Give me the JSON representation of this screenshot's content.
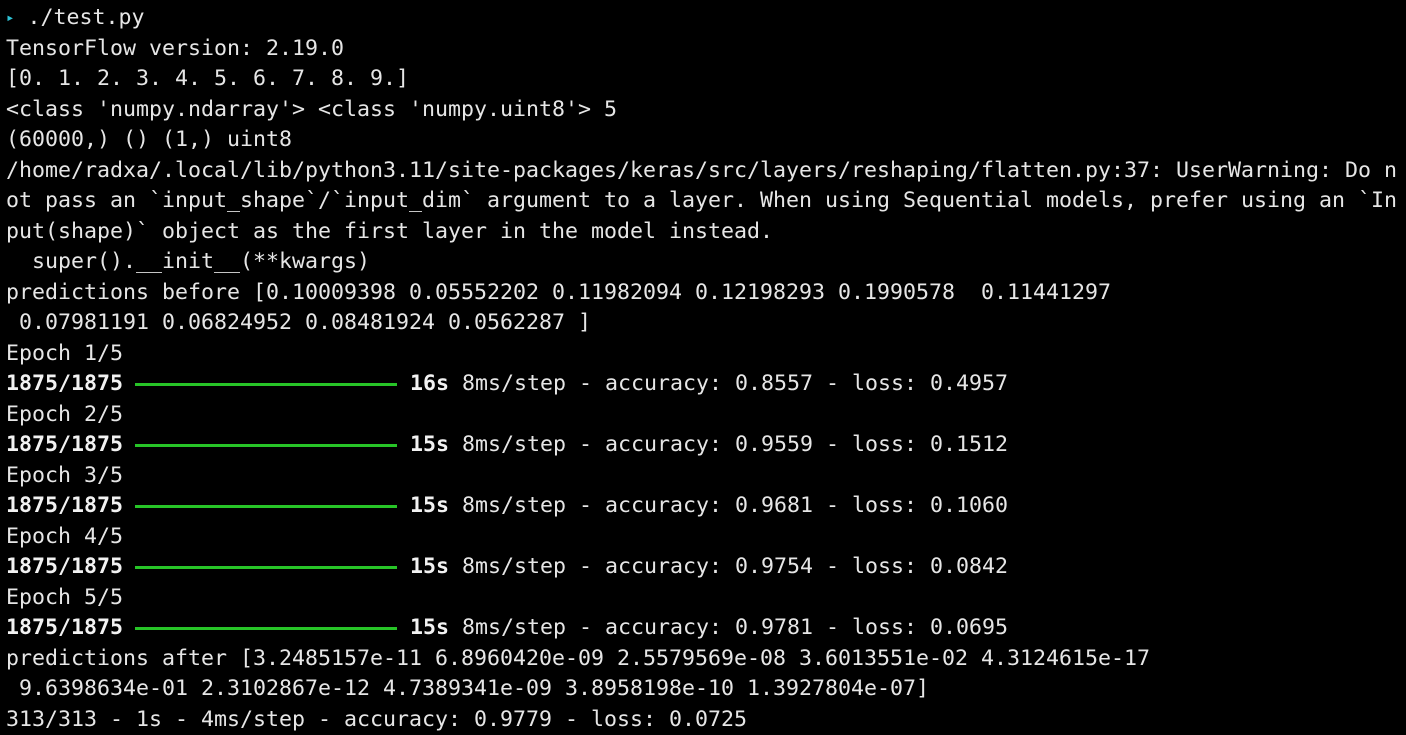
{
  "colors": {
    "background": "#000000",
    "text": "#e6e6e6",
    "prompt": "#2ec3d6",
    "progress_bar": "#27c427"
  },
  "prompt": {
    "icon": "triangle-right",
    "command": "./test.py"
  },
  "lines": [
    "TensorFlow version: 2.19.0",
    "[0. 1. 2. 3. 4. 5. 6. 7. 8. 9.]",
    "<class 'numpy.ndarray'> <class 'numpy.uint8'> 5",
    "(60000,) () (1,) uint8",
    "/home/radxa/.local/lib/python3.11/site-packages/keras/src/layers/reshaping/flatten.py:37: UserWarning: Do n",
    "ot pass an `input_shape`/`input_dim` argument to a layer. When using Sequential models, prefer using an `In",
    "put(shape)` object as the first layer in the model instead.",
    "  super().__init__(**kwargs)",
    "predictions before [0.10009398 0.05552202 0.11982094 0.12198293 0.1990578  0.11441297",
    " 0.07981191 0.06824952 0.08481924 0.0562287 ]"
  ],
  "epochs": [
    {
      "label": "Epoch 1/5",
      "steps": "1875/1875",
      "progress": 1.0,
      "time": "16s",
      "rest": " 8ms/step - accuracy: 0.8557 - loss: 0.4957"
    },
    {
      "label": "Epoch 2/5",
      "steps": "1875/1875",
      "progress": 1.0,
      "time": "15s",
      "rest": " 8ms/step - accuracy: 0.9559 - loss: 0.1512"
    },
    {
      "label": "Epoch 3/5",
      "steps": "1875/1875",
      "progress": 1.0,
      "time": "15s",
      "rest": " 8ms/step - accuracy: 0.9681 - loss: 0.1060"
    },
    {
      "label": "Epoch 4/5",
      "steps": "1875/1875",
      "progress": 1.0,
      "time": "15s",
      "rest": " 8ms/step - accuracy: 0.9754 - loss: 0.0842"
    },
    {
      "label": "Epoch 5/5",
      "steps": "1875/1875",
      "progress": 1.0,
      "time": "15s",
      "rest": " 8ms/step - accuracy: 0.9781 - loss: 0.0695"
    }
  ],
  "after_lines": [
    "predictions after [3.2485157e-11 6.8960420e-09 2.5579569e-08 3.6013551e-02 4.3124615e-17",
    " 9.6398634e-01 2.3102867e-12 4.7389341e-09 3.8958198e-10 1.3927804e-07]",
    "313/313 - 1s - 4ms/step - accuracy: 0.9779 - loss: 0.0725"
  ]
}
